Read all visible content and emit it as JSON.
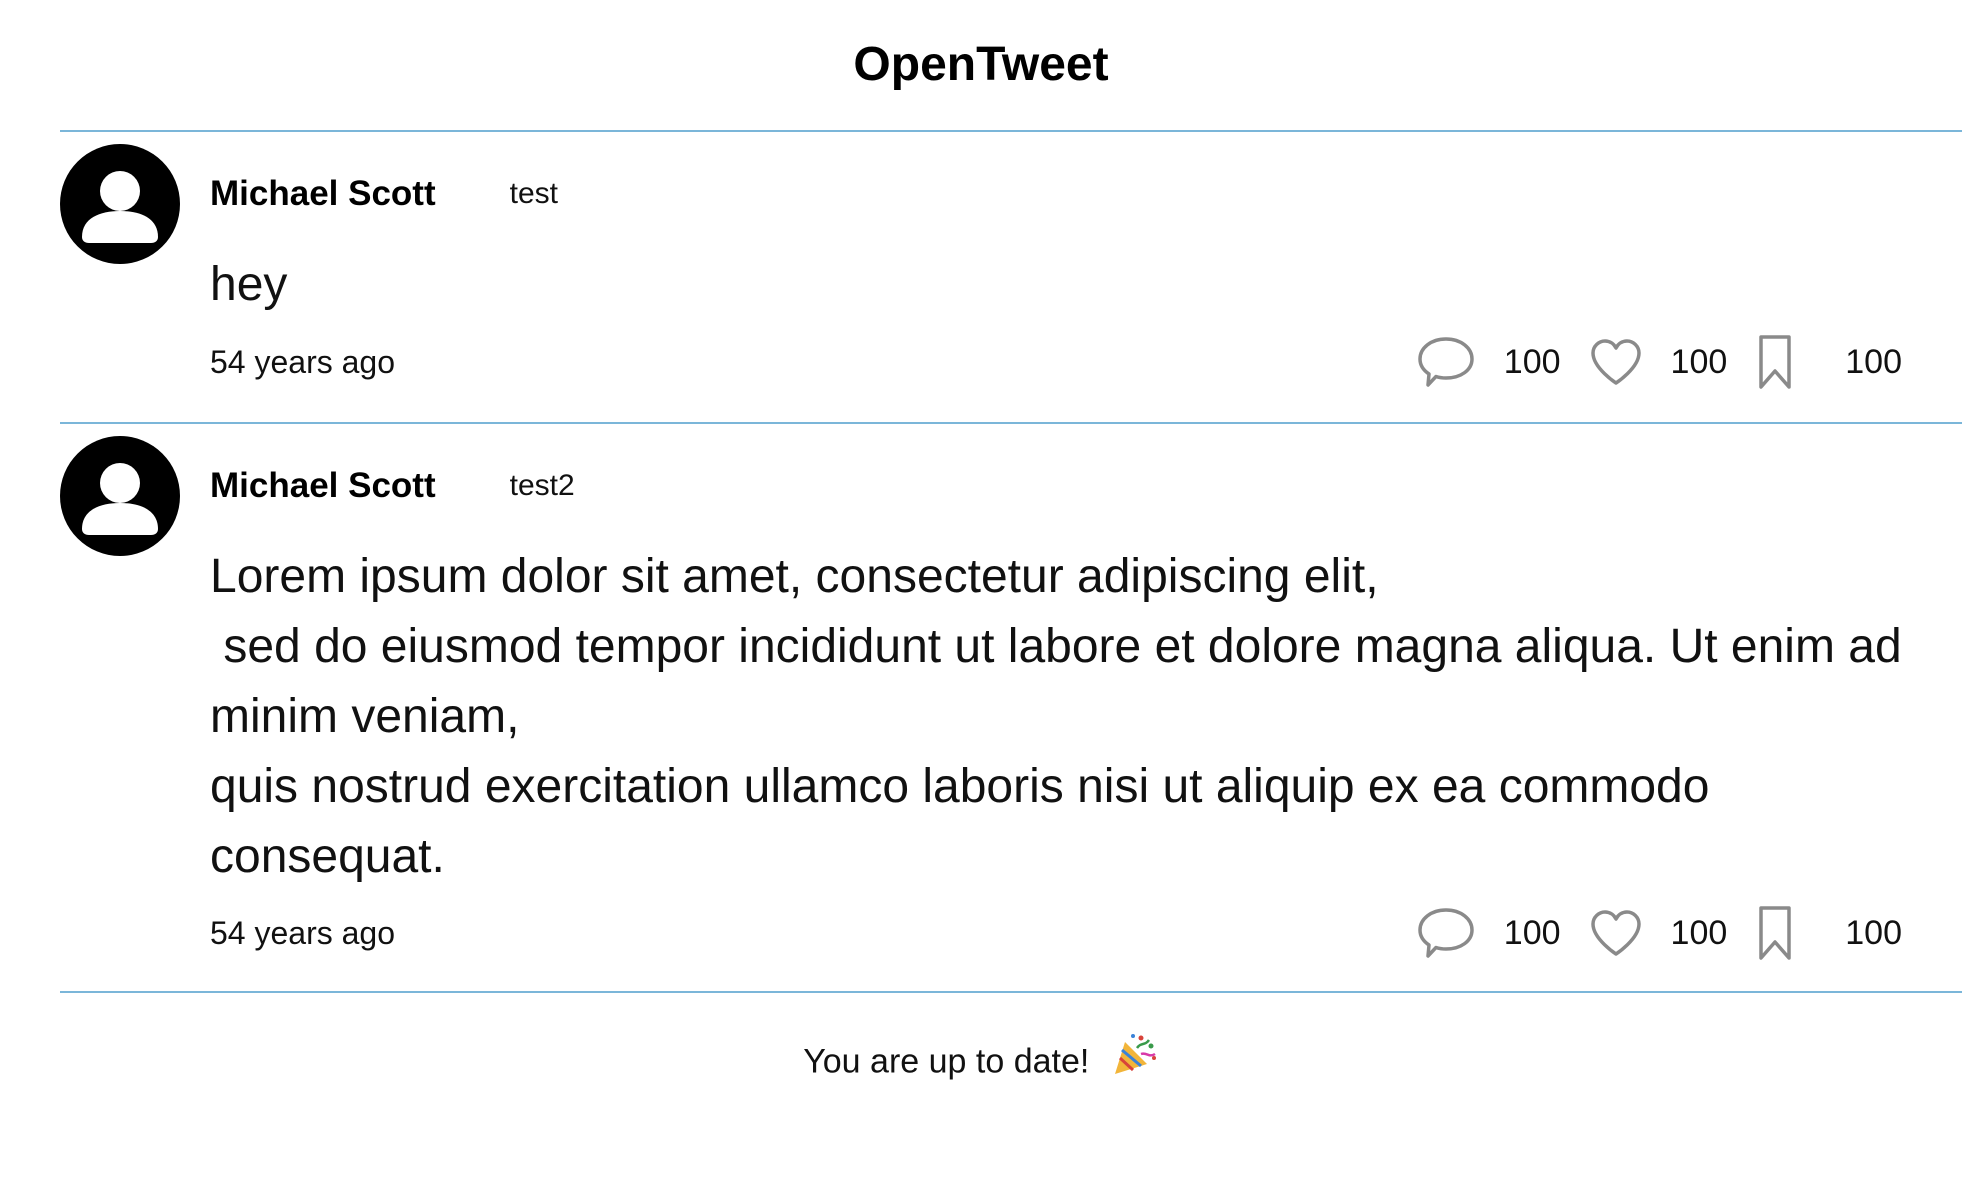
{
  "app": {
    "title": "OpenTweet"
  },
  "tweets": [
    {
      "author": "Michael Scott",
      "handle": "test",
      "content": "hey",
      "timestamp": "54 years ago",
      "replies": "100",
      "likes": "100",
      "bookmarks": "100"
    },
    {
      "author": "Michael Scott",
      "handle": "test2",
      "content": "Lorem ipsum dolor sit amet, consectetur adipiscing elit,\n sed do eiusmod tempor incididunt ut labore et dolore magna aliqua. Ut enim ad minim veniam,\nquis nostrud exercitation ullamco laboris nisi ut aliquip ex ea commodo consequat.",
      "timestamp": "54 years ago",
      "replies": "100",
      "likes": "100",
      "bookmarks": "100"
    }
  ],
  "feed_end": {
    "message": "You are up to date!",
    "icon": "party-popper-icon"
  },
  "colors": {
    "divider": "#7bb6d9",
    "icon_stroke": "#8a8a8a",
    "avatar": "#000000"
  }
}
